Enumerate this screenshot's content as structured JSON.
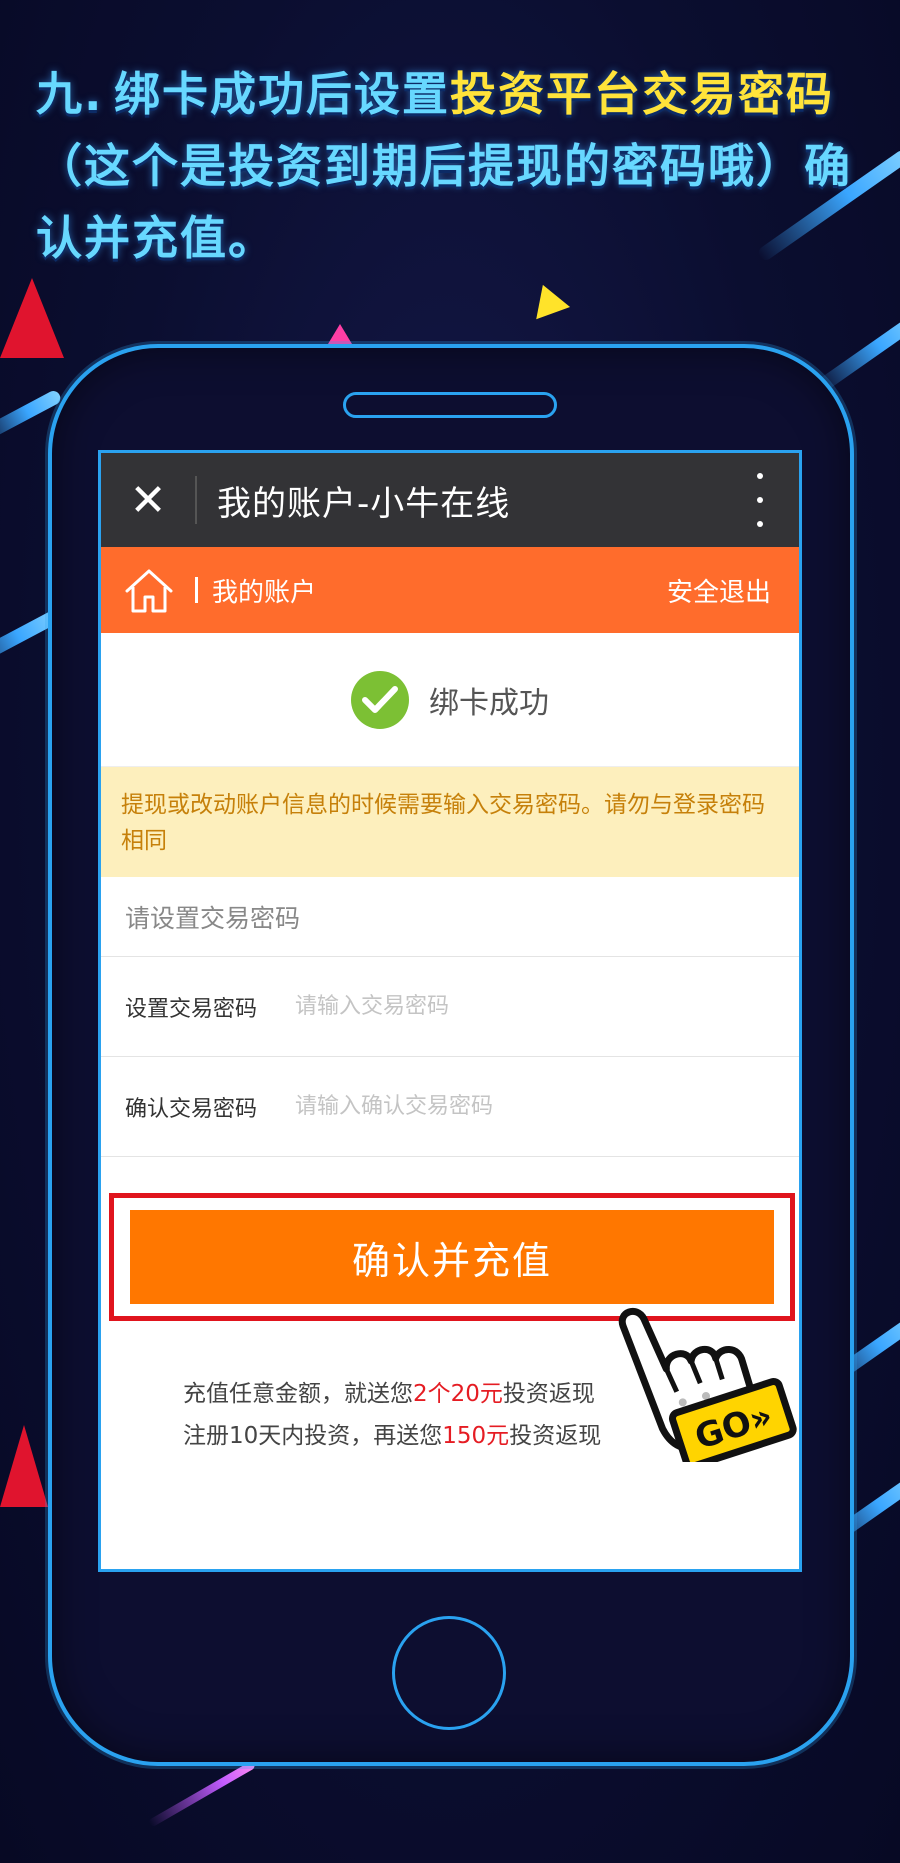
{
  "heading": {
    "number": "九.",
    "part1": "绑卡成功后设置",
    "highlight": "投资平台交易密码",
    "part2": "（这个是投资到期后提现的密码哦）确认并充值。"
  },
  "browser": {
    "title": "我的账户-小牛在线"
  },
  "nav": {
    "title": "我的账户",
    "logout_label": "安全退出"
  },
  "status": {
    "text": "绑卡成功"
  },
  "notice": {
    "text": "提现或改动账户信息的时候需要输入交易密码。请勿与登录密码相同"
  },
  "form": {
    "section_title": "请设置交易密码",
    "password_label": "设置交易密码",
    "password_placeholder": "请输入交易密码",
    "confirm_label": "确认交易密码",
    "confirm_placeholder": "请输入确认交易密码",
    "submit_label": "确认并充值"
  },
  "promo": {
    "line1_prefix": "充值任意金额，就送您",
    "line1_highlight": "2个20元",
    "line1_suffix": "投资返现",
    "line2_prefix": "注册10天内投资，再送您",
    "line2_highlight": "150元",
    "line2_suffix": "投资返现"
  },
  "pointer": {
    "go_label": "GO»"
  },
  "colors": {
    "accent_orange": "#ff6c2c",
    "button_orange": "#ff7700",
    "highlight_red": "#e51c23",
    "notice_bg": "#fdefbd",
    "phone_outline": "#2aa2f0"
  }
}
